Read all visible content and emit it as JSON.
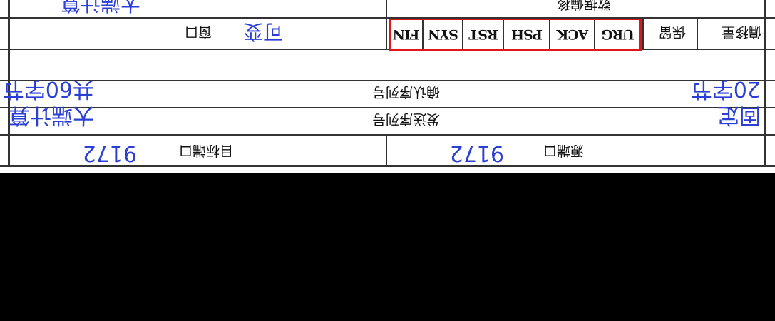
{
  "header_row": {
    "left_label": "窗口",
    "left_value": "可变",
    "flags": [
      "FIN",
      "SYN",
      "RST",
      "PSH",
      "ACK",
      "URG"
    ],
    "reserved_label": "保留",
    "offset_label": "偏移量"
  },
  "rows": {
    "ack_label": "确认序列号",
    "ack_left": "共60字节",
    "ack_right": "20字节",
    "seq_label": "发送序列号",
    "seq_left": "大端计算",
    "seq_right": "固定"
  },
  "ports": {
    "dest_label": "目标端口",
    "dest_value": "9172",
    "src_label": "源端口",
    "src_value": "9172"
  },
  "top_partial": {
    "left_text": "大端计算",
    "mid_text": "数据偏移"
  },
  "colors": {
    "ink": "#111111",
    "handwriting": "#2b3fd6",
    "highlight": "#e0161b",
    "background": "#000000"
  }
}
